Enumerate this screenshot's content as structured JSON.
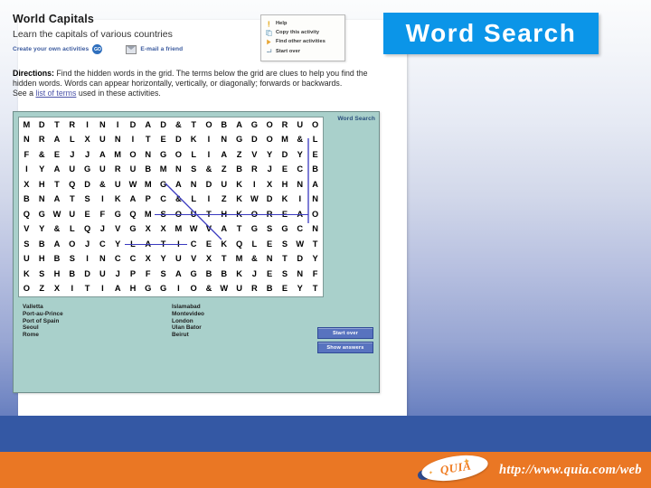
{
  "banner": {
    "title": "Word Search"
  },
  "activity": {
    "title": "World Capitals",
    "subtitle": "Learn the capitals of various countries",
    "create_link": "Create your own activities",
    "go_badge": "GO",
    "email_link": "E-mail a friend"
  },
  "menu": {
    "items": [
      {
        "label": "Help",
        "icon": "help-icon"
      },
      {
        "label": "Copy this activity",
        "icon": "copy-icon"
      },
      {
        "label": "Find other activities",
        "icon": "find-icon"
      },
      {
        "label": "Start over",
        "icon": "start-over-icon"
      }
    ]
  },
  "directions": {
    "label": "Directions:",
    "body": " Find the hidden words in the grid. The terms below the grid are clues to help you find the hidden words. Words can appear horizontally, vertically, or diagonally; forwards or backwards.",
    "see_prefix": "See a ",
    "link": "list of terms",
    "see_suffix": " used in these activities."
  },
  "puzzle": {
    "tab_label": "Word Search",
    "grid": [
      [
        "M",
        "D",
        "T",
        "R",
        "I",
        "N",
        "I",
        "D",
        "A",
        "D",
        "&",
        "T",
        "O",
        "B",
        "A",
        "G",
        "O",
        "R",
        "U",
        "O"
      ],
      [
        "N",
        "R",
        "A",
        "L",
        "X",
        "U",
        "N",
        "I",
        "T",
        "E",
        "D",
        "K",
        "I",
        "N",
        "G",
        "D",
        "O",
        "M",
        "&",
        "L"
      ],
      [
        "F",
        "&",
        "E",
        "J",
        "J",
        "A",
        "M",
        "O",
        "N",
        "G",
        "O",
        "L",
        "I",
        "A",
        "Z",
        "V",
        "Y",
        "D",
        "Y",
        "E"
      ],
      [
        "I",
        "Y",
        "A",
        "U",
        "G",
        "U",
        "R",
        "U",
        "B",
        "M",
        "N",
        "S",
        "&",
        "Z",
        "B",
        "R",
        "J",
        "E",
        "C",
        "B"
      ],
      [
        "X",
        "H",
        "T",
        "Q",
        "D",
        "&",
        "U",
        "W",
        "M",
        "G",
        "A",
        "N",
        "D",
        "U",
        "K",
        "I",
        "X",
        "H",
        "N",
        "A"
      ],
      [
        "B",
        "N",
        "A",
        "T",
        "S",
        "I",
        "K",
        "A",
        "P",
        "C",
        "&",
        "L",
        "I",
        "Z",
        "K",
        "W",
        "D",
        "K",
        "I",
        "N"
      ],
      [
        "Q",
        "G",
        "W",
        "U",
        "E",
        "F",
        "G",
        "Q",
        "M",
        "S",
        "O",
        "U",
        "T",
        "H",
        "K",
        "O",
        "R",
        "E",
        "A",
        "O"
      ],
      [
        "V",
        "Y",
        "&",
        "L",
        "Q",
        "J",
        "V",
        "G",
        "X",
        "X",
        "M",
        "W",
        "V",
        "A",
        "T",
        "G",
        "S",
        "G",
        "C",
        "N"
      ],
      [
        "S",
        "B",
        "A",
        "O",
        "J",
        "C",
        "Y",
        "L",
        "A",
        "T",
        "I",
        "C",
        "E",
        "K",
        "Q",
        "L",
        "E",
        "S",
        "W",
        "T"
      ],
      [
        "U",
        "H",
        "B",
        "S",
        "I",
        "N",
        "C",
        "C",
        "X",
        "Y",
        "U",
        "V",
        "X",
        "T",
        "M",
        "&",
        "N",
        "T",
        "D",
        "Y"
      ],
      [
        "K",
        "S",
        "H",
        "B",
        "D",
        "U",
        "J",
        "P",
        "F",
        "S",
        "A",
        "G",
        "B",
        "B",
        "K",
        "J",
        "E",
        "S",
        "N",
        "F"
      ],
      [
        "O",
        "Z",
        "X",
        "I",
        "T",
        "I",
        "A",
        "H",
        "G",
        "G",
        "I",
        "O",
        "&",
        "W",
        "U",
        "R",
        "B",
        "E",
        "Y",
        "T"
      ]
    ],
    "found_cells": [
      {
        "row": 6,
        "cols": [
          9,
          10,
          11,
          12,
          13,
          14,
          15,
          16,
          17,
          18
        ]
      },
      {
        "row": 8,
        "cols": [
          7,
          8,
          9,
          10
        ]
      }
    ],
    "answer_color": "#3a3ac0",
    "words_left": [
      "Valletta",
      "Port-au-Prince",
      "Port of Spain",
      "Seoul",
      "Rome"
    ],
    "words_right": [
      "Islamabad",
      "Montevideo",
      "London",
      "Ulan Bator",
      "Beirut"
    ],
    "buttons": [
      "Start over",
      "Show answers"
    ]
  },
  "footer": {
    "logo_text": "QUIA",
    "url": "http://www.quia.com/web"
  },
  "colors": {
    "banner_blue": "#0b95e8",
    "panel_teal": "#a9d0cb",
    "footer_blue": "#3458a4",
    "footer_orange": "#ea7724",
    "button_blue": "#5873bf"
  }
}
